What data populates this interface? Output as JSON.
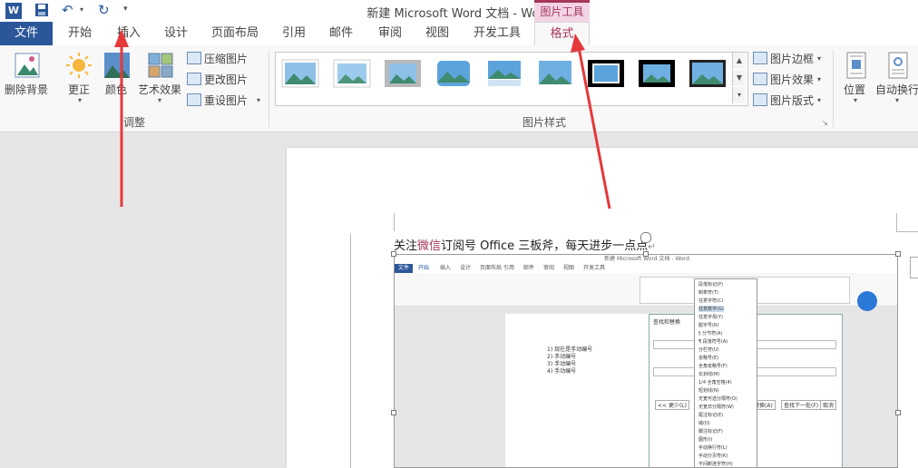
{
  "title_bar": {
    "title": "新建 Microsoft Word 文档 - Word",
    "app_icon": "W",
    "context_tab_group": "图片工具",
    "quick_access": [
      "save-icon",
      "undo-icon",
      "redo-icon",
      "customize-qat-icon"
    ]
  },
  "tabs": [
    "文件",
    "开始",
    "插入",
    "设计",
    "页面布局",
    "引用",
    "邮件",
    "审阅",
    "视图",
    "开发工具",
    "格式"
  ],
  "ribbon": {
    "remove_bg": "删除背景",
    "corrections": "更正",
    "color": "颜色",
    "artistic": "艺术效果",
    "compress": "压缩图片",
    "change": "更改图片",
    "reset": "重设图片",
    "adjust_group": "调整",
    "styles_group": "图片样式",
    "border": "图片边框",
    "effects": "图片效果",
    "layout": "图片版式",
    "position": "位置",
    "wrap": "自动换行"
  },
  "document": {
    "line_prefix": "关注",
    "line_highlight": "微信",
    "line_suffix": "订阅号  Office 三板斧，每天进步一点点"
  },
  "embedded": {
    "title": "新建 Microsoft Word 文档 - Word",
    "tabs": [
      "文件",
      "开始",
      "插入",
      "设计",
      "页面布局",
      "引用",
      "邮件",
      "审阅",
      "视图",
      "开发工具"
    ],
    "list_lines": [
      "1)  现在是手动编号",
      "2)  手动编号",
      "3)  手动编号",
      "4)  手动编号"
    ],
    "dropdown_items": [
      "段落标记(P)",
      "制表符(T)",
      "任意字符(C)",
      "任意数字(G)",
      "任意字母(Y)",
      "脱字号(R)",
      "§ 分节符(A)",
      "¶ 段落符号(A)",
      "分栏符(U)",
      "省略号(E)",
      "全角省略号(F)",
      "长划线(M)",
      "1/4 全角空格(4)",
      "短划线(N)",
      "无宽可选分隔符(O)",
      "无宽非分隔符(W)",
      "尾注标记(E)",
      "域(D)",
      "脚注标记(F)",
      "图形(I)",
      "手动换行符(L)",
      "手动分页符(K)",
      "不间断连字符(H)"
    ],
    "dialog_title": "查找和替换",
    "dialog_buttons": [
      "<< 更少(L)",
      "替换(A)",
      "查找下一处(F)",
      "取消"
    ]
  }
}
